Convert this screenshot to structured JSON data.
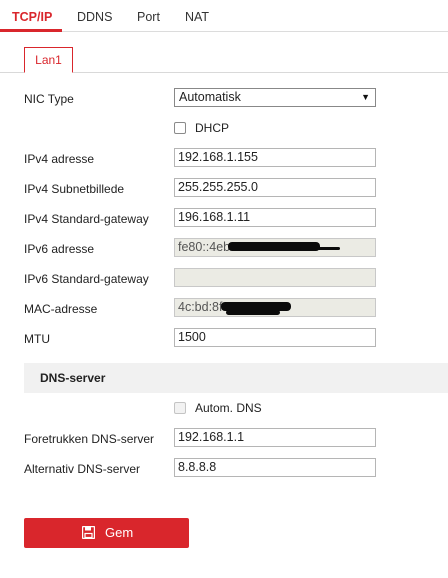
{
  "tabs": [
    "TCP/IP",
    "DDNS",
    "Port",
    "NAT"
  ],
  "subtab": "Lan1",
  "nic": {
    "label": "NIC Type",
    "value": "Automatisk"
  },
  "dhcp": {
    "label": "DHCP",
    "checked": false
  },
  "fields": [
    {
      "label": "IPv4 adresse",
      "value": "192.168.1.155",
      "disabled": false
    },
    {
      "label": "IPv4 Subnetbillede",
      "value": "255.255.255.0",
      "disabled": false
    },
    {
      "label": "IPv4 Standard-gateway",
      "value": "196.168.1.11",
      "disabled": false
    },
    {
      "label": "IPv6 adresse",
      "value": "fe80::4eb",
      "disabled": true
    },
    {
      "label": "IPv6 Standard-gateway",
      "value": "",
      "disabled": true
    },
    {
      "label": "MAC-adresse",
      "value": "4c:bd:8f",
      "disabled": true
    },
    {
      "label": "MTU",
      "value": "1500",
      "disabled": false
    }
  ],
  "dns_section": {
    "title": "DNS-server"
  },
  "auto_dns": {
    "label": "Autom. DNS",
    "checked": false
  },
  "dns_fields": [
    {
      "label": "Foretrukken DNS-server",
      "value": "192.168.1.1"
    },
    {
      "label": "Alternativ DNS-server",
      "value": "8.8.8.8"
    }
  ],
  "save_label": "Gem",
  "colors": {
    "accent": "#d9262c"
  }
}
